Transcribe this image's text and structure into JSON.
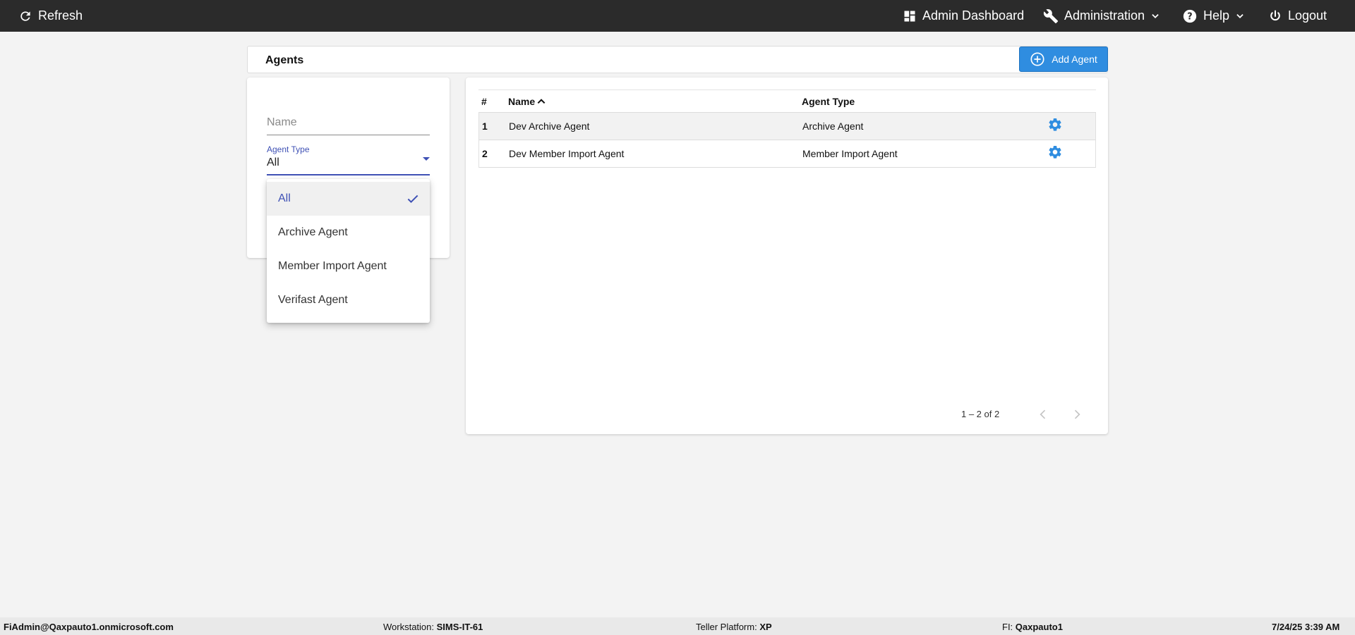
{
  "topbar": {
    "refresh": "Refresh",
    "admin_dashboard": "Admin Dashboard",
    "administration": "Administration",
    "help": "Help",
    "logout": "Logout"
  },
  "page": {
    "title": "Agents",
    "add_agent": "Add Agent"
  },
  "filters": {
    "name_placeholder": "Name",
    "agent_type_label": "Agent Type",
    "agent_type_value": "All",
    "options": [
      {
        "label": "All",
        "selected": true
      },
      {
        "label": "Archive Agent",
        "selected": false
      },
      {
        "label": "Member Import Agent",
        "selected": false
      },
      {
        "label": "Verifast Agent",
        "selected": false
      }
    ]
  },
  "table": {
    "columns": [
      "#",
      "Name",
      "Agent Type"
    ],
    "rows": [
      {
        "num": "1",
        "name": "Dev Archive Agent",
        "type": "Archive Agent"
      },
      {
        "num": "2",
        "name": "Dev Member Import Agent",
        "type": "Member Import Agent"
      }
    ],
    "pager": "1 – 2 of 2"
  },
  "status": {
    "user": "FiAdmin@Qaxpauto1.onmicrosoft.com",
    "workstation_label": "Workstation:",
    "workstation": "SIMS-IT-61",
    "platform_label": "Teller Platform:",
    "platform": "XP",
    "fi_label": "FI:",
    "fi": "Qaxpauto1",
    "datetime": "7/24/25 3:39 AM"
  },
  "colors": {
    "topbar": "#2b2b2b",
    "accent": "#3f51b5",
    "button": "#2f8de0",
    "gear": "#2f8de0"
  },
  "icons": [
    "refresh-icon",
    "dashboard-icon",
    "wrench-icon",
    "chevron-down-icon",
    "help-icon",
    "power-icon",
    "add-circle-icon",
    "check-icon",
    "gear-icon",
    "sort-up-icon",
    "chevron-left-icon",
    "chevron-right-icon"
  ]
}
